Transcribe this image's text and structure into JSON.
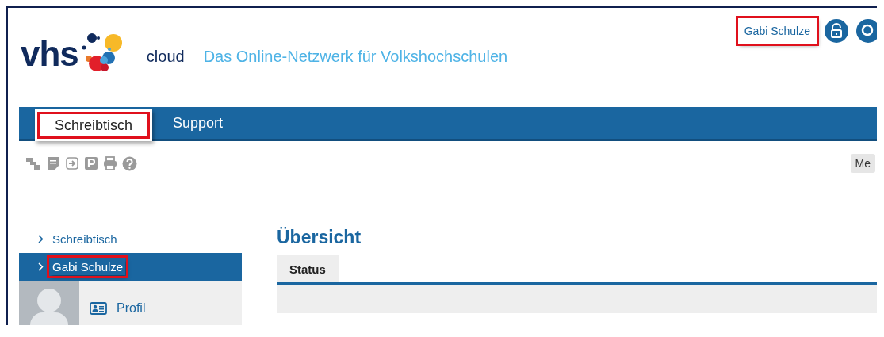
{
  "header": {
    "logo_text": "vhs",
    "product": "cloud",
    "tagline": "Das Online-Netzwerk für Volkshochschulen",
    "user_name": {
      "text": "Gabi Schulze",
      "highlighted": true
    }
  },
  "nav_tabs": [
    {
      "label": "Schreibtisch",
      "selected": true,
      "highlighted": true
    },
    {
      "label": "Support",
      "selected": false,
      "highlighted": false
    }
  ],
  "toolbar": {
    "more_button": "Me"
  },
  "sidebar": {
    "items": [
      {
        "label": "Schreibtisch",
        "selected": false,
        "highlighted": false
      },
      {
        "label": "Gabi Schulze",
        "selected": true,
        "highlighted": true
      }
    ],
    "profile_link": "Profil"
  },
  "main": {
    "title": "Übersicht",
    "tabs": [
      {
        "label": "Status",
        "selected": true
      }
    ]
  }
}
